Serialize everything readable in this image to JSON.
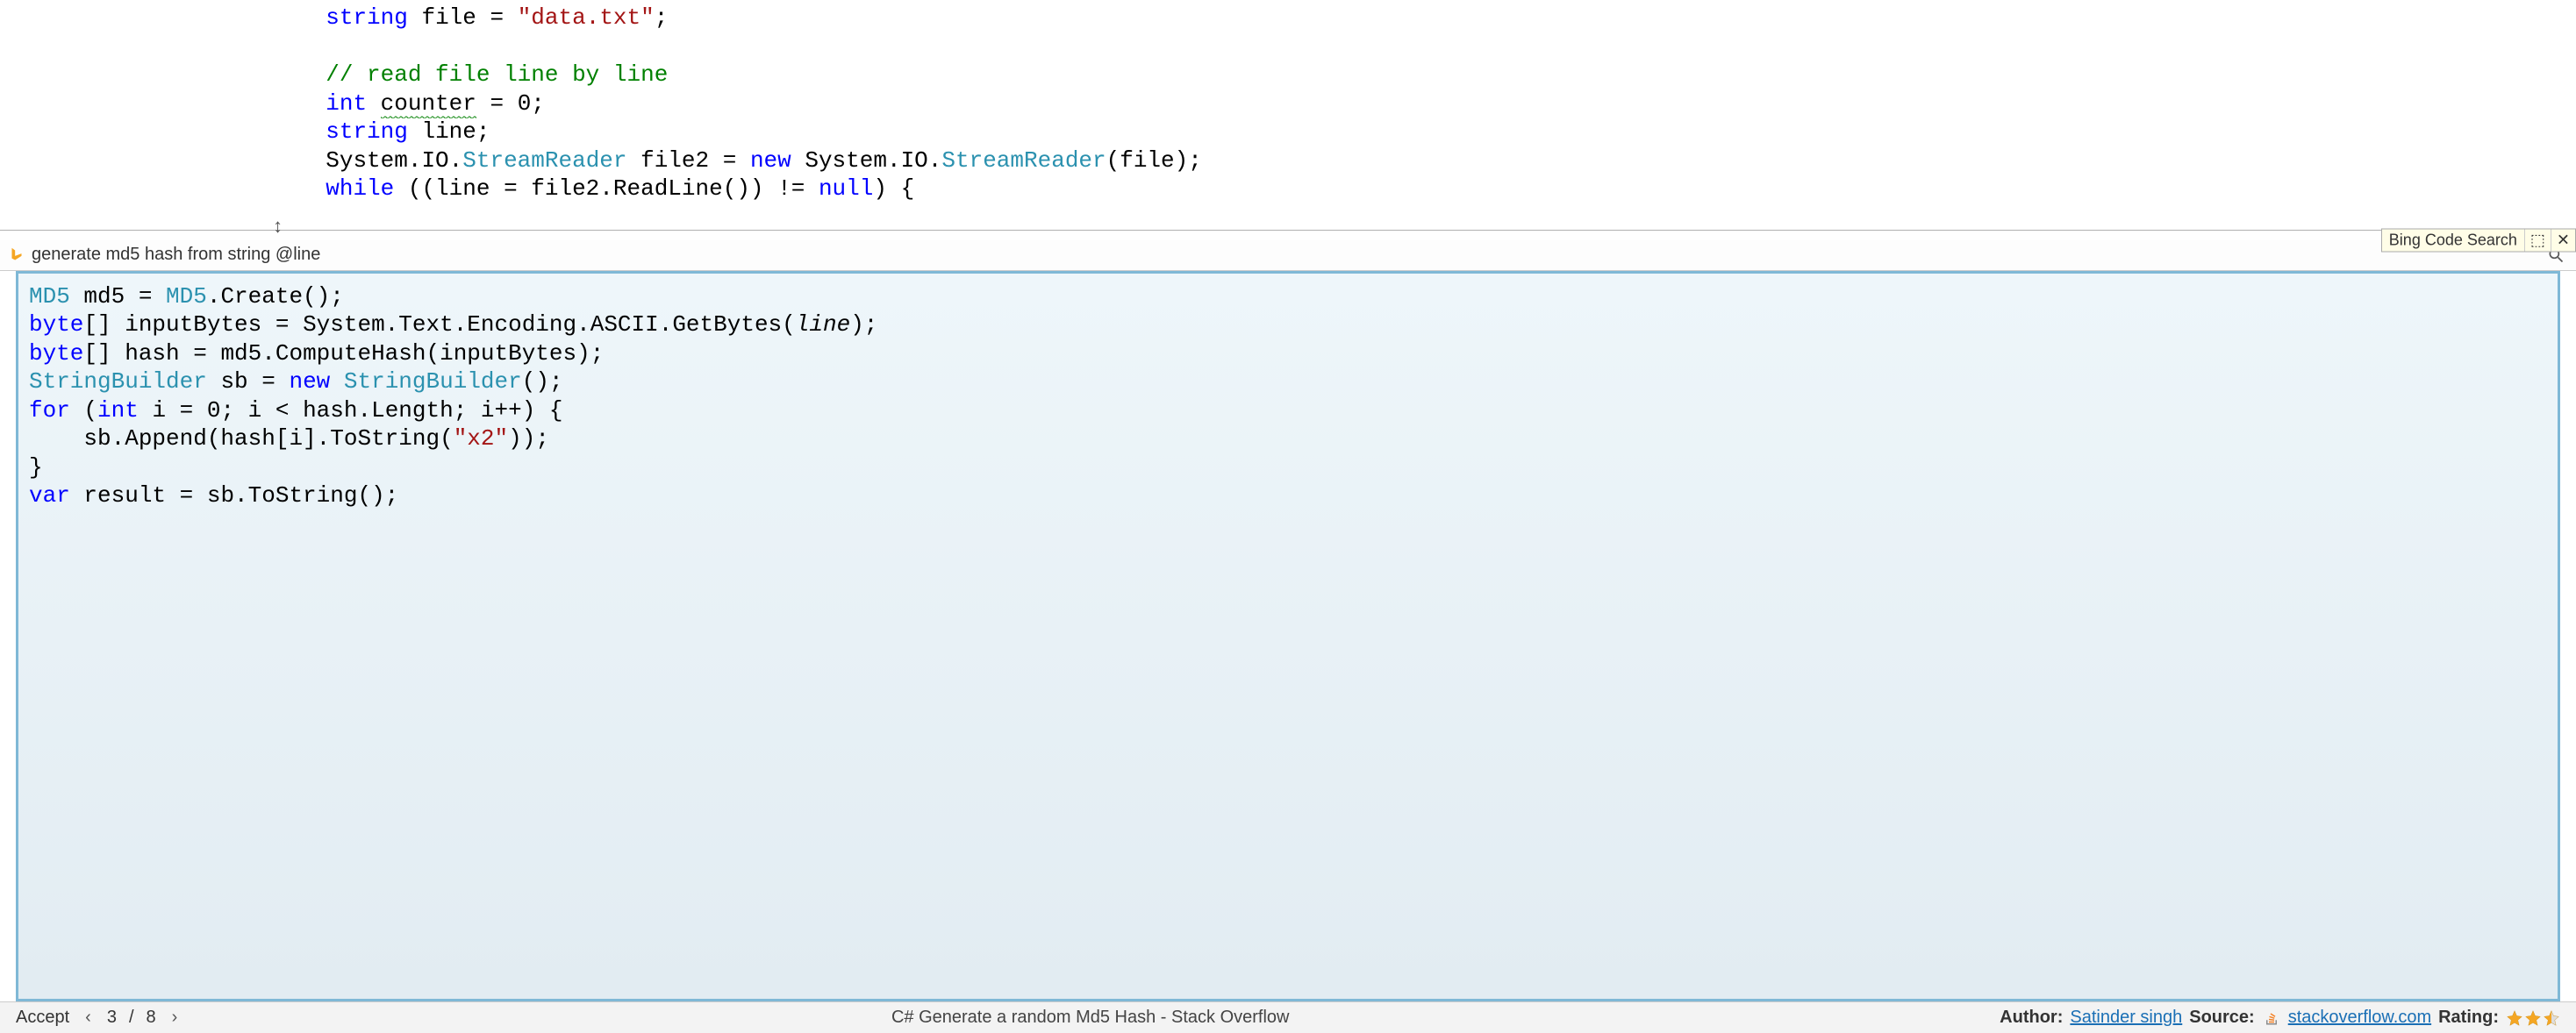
{
  "editor": {
    "lines": [
      [
        {
          "t": "            ",
          "c": "pun"
        },
        {
          "t": "string",
          "c": "kw"
        },
        {
          "t": " ",
          "c": "pun"
        },
        {
          "t": "file",
          "c": "id"
        },
        {
          "t": " = ",
          "c": "pun"
        },
        {
          "t": "\"data.txt\"",
          "c": "str"
        },
        {
          "t": ";",
          "c": "pun"
        }
      ],
      [],
      [
        {
          "t": "            ",
          "c": "pun"
        },
        {
          "t": "// read file line by line",
          "c": "com"
        }
      ],
      [
        {
          "t": "            ",
          "c": "pun"
        },
        {
          "t": "int",
          "c": "kw"
        },
        {
          "t": " ",
          "c": "pun"
        },
        {
          "t": "counter",
          "c": "id",
          "squiggle": true
        },
        {
          "t": " = ",
          "c": "pun"
        },
        {
          "t": "0",
          "c": "num"
        },
        {
          "t": ";",
          "c": "pun"
        }
      ],
      [
        {
          "t": "            ",
          "c": "pun"
        },
        {
          "t": "string",
          "c": "kw"
        },
        {
          "t": " ",
          "c": "pun"
        },
        {
          "t": "line",
          "c": "id"
        },
        {
          "t": ";",
          "c": "pun"
        }
      ],
      [
        {
          "t": "            ",
          "c": "pun"
        },
        {
          "t": "System.IO.",
          "c": "id"
        },
        {
          "t": "StreamReader",
          "c": "type"
        },
        {
          "t": " file2 = ",
          "c": "id"
        },
        {
          "t": "new",
          "c": "kw"
        },
        {
          "t": " System.IO.",
          "c": "id"
        },
        {
          "t": "StreamReader",
          "c": "type"
        },
        {
          "t": "(file);",
          "c": "id"
        }
      ],
      [
        {
          "t": "            ",
          "c": "pun"
        },
        {
          "t": "while",
          "c": "kw"
        },
        {
          "t": " ((line = file2.ReadLine()) != ",
          "c": "id"
        },
        {
          "t": "null",
          "c": "kw"
        },
        {
          "t": ") {",
          "c": "id"
        }
      ]
    ]
  },
  "panel_tab": {
    "label": "Bing Code Search",
    "pin_glyph": "⬚",
    "close_glyph": "✕"
  },
  "search": {
    "query": "generate md5 hash from string @line",
    "placeholder": ""
  },
  "result": {
    "lines": [
      [
        {
          "t": "MD5",
          "c": "type"
        },
        {
          "t": " md5 = ",
          "c": "id"
        },
        {
          "t": "MD5",
          "c": "type"
        },
        {
          "t": ".Create();",
          "c": "id"
        }
      ],
      [
        {
          "t": "byte",
          "c": "kw"
        },
        {
          "t": "[] inputBytes = System.Text.Encoding.ASCII.GetBytes(",
          "c": "id"
        },
        {
          "t": "line",
          "c": "id",
          "hl": true
        },
        {
          "t": ");",
          "c": "id"
        }
      ],
      [
        {
          "t": "byte",
          "c": "kw"
        },
        {
          "t": "[] hash = md5.ComputeHash(inputBytes);",
          "c": "id"
        }
      ],
      [
        {
          "t": "StringBuilder",
          "c": "type"
        },
        {
          "t": " sb = ",
          "c": "id"
        },
        {
          "t": "new",
          "c": "kw"
        },
        {
          "t": " ",
          "c": "id"
        },
        {
          "t": "StringBuilder",
          "c": "type"
        },
        {
          "t": "();",
          "c": "id"
        }
      ],
      [
        {
          "t": "for",
          "c": "kw"
        },
        {
          "t": " (",
          "c": "id"
        },
        {
          "t": "int",
          "c": "kw"
        },
        {
          "t": " i = ",
          "c": "id"
        },
        {
          "t": "0",
          "c": "num"
        },
        {
          "t": "; i < hash.Length; i++) {",
          "c": "id"
        }
      ],
      [
        {
          "t": "    sb.Append(hash[i].ToString(",
          "c": "id"
        },
        {
          "t": "\"x2\"",
          "c": "str"
        },
        {
          "t": "));",
          "c": "id"
        }
      ],
      [
        {
          "t": "}",
          "c": "id"
        }
      ],
      [
        {
          "t": "var",
          "c": "kw"
        },
        {
          "t": " result = sb.ToString();",
          "c": "id"
        }
      ]
    ]
  },
  "footer": {
    "accept": "Accept",
    "page_current": "3",
    "page_sep": "/",
    "page_total": "8",
    "title": "C# Generate a random Md5 Hash - Stack Overflow",
    "author_label": "Author:",
    "author_name": "Satinder singh",
    "source_label": "Source:",
    "source_name": "stackoverflow.com",
    "rating_label": "Rating:",
    "rating_value": 2.5,
    "rating_max": 3
  },
  "colors": {
    "keyword": "#0000ff",
    "type": "#2b91af",
    "string": "#a31515",
    "comment": "#008000",
    "result_border": "#7fb8d6",
    "star_fill": "#f5a623"
  }
}
